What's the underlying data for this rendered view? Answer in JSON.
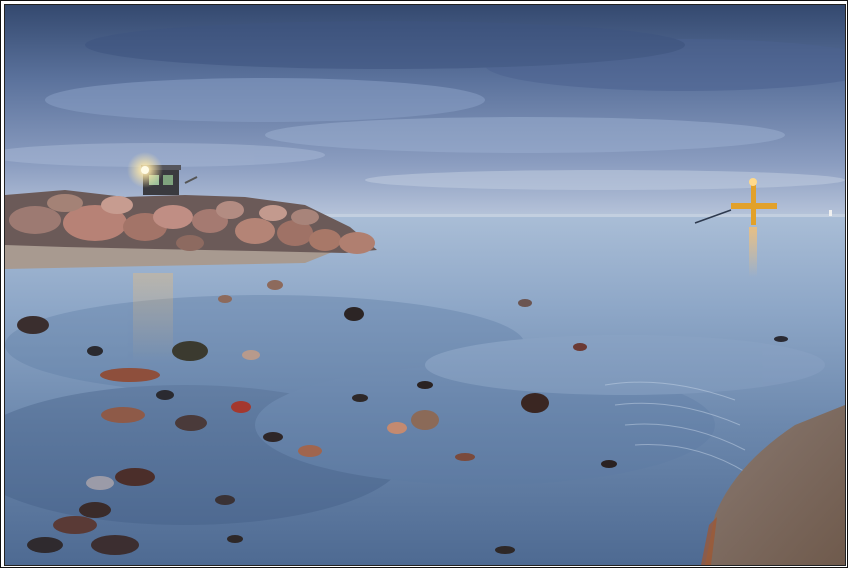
{
  "scene": {
    "subject": "seaside-dusk",
    "colors": {
      "sky_top": "#3d5580",
      "sky_mid": "#7f93b8",
      "horizon": "#b9c6da",
      "sea_far": "#9eb4cf",
      "sea_near": "#4d6b93",
      "sand": "#8b7768",
      "rock": "#a07a70",
      "beacon_light": "#ffe9a8",
      "marker_buoy": "#e2a12a"
    }
  }
}
